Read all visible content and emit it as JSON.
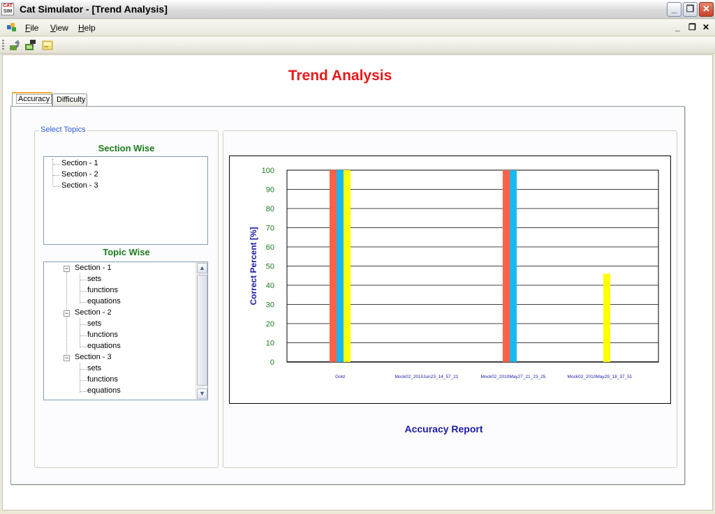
{
  "window": {
    "icon_text_top": "CAT",
    "icon_text_bottom": "SIM",
    "title": "Cat Simulator - [Trend Analysis]",
    "minimize": "_",
    "restore": "❐",
    "close": "✕"
  },
  "menu": {
    "items": [
      {
        "label": "File",
        "accel": "F"
      },
      {
        "label": "View",
        "accel": "V"
      },
      {
        "label": "Help",
        "accel": "H"
      }
    ],
    "mdi_minimize": "_",
    "mdi_restore": "❐",
    "mdi_close": "✕"
  },
  "toolbar": {
    "buttons": [
      "help-icon",
      "tools-icon",
      "report-icon"
    ]
  },
  "page": {
    "title": "Trend Analysis",
    "tabs": [
      {
        "label": "Accuracy",
        "active": true
      },
      {
        "label": "Difficulty",
        "active": false
      }
    ]
  },
  "topics": {
    "group_label": "Select Topics",
    "section_wise_heading": "Section Wise",
    "section_items": [
      "Section - 1",
      "Section - 2",
      "Section - 3"
    ],
    "topic_wise_heading": "Topic Wise",
    "topic_tree": [
      {
        "label": "Section - 1",
        "children": [
          "sets",
          "functions",
          "equations"
        ]
      },
      {
        "label": "Section - 2",
        "children": [
          "sets",
          "functions",
          "equations"
        ]
      },
      {
        "label": "Section - 3",
        "children": [
          "sets",
          "functions",
          "equations"
        ]
      }
    ],
    "expander_glyph": "−"
  },
  "chart_data": {
    "type": "bar",
    "title": "",
    "caption": "Accuracy Report",
    "xlabel": "",
    "ylabel": "Correct Percent [%]",
    "ylim": [
      0,
      100
    ],
    "yticks": [
      0,
      10,
      20,
      30,
      40,
      50,
      60,
      70,
      80,
      90,
      100
    ],
    "grid": true,
    "categories": [
      "Gold",
      "Mock02_2010Jun23_14_57_21",
      "Mock02_2010May27_21_23_25",
      "Mock02_2010May29_18_37_51"
    ],
    "series": [
      {
        "color": "#ff6347",
        "values": [
          100,
          0,
          100,
          0
        ]
      },
      {
        "color": "#1ab8f0",
        "values": [
          100,
          0,
          100,
          0
        ]
      },
      {
        "color": "#ffff00",
        "values": [
          100,
          0,
          0,
          46
        ]
      }
    ],
    "colors": {
      "tick_label": "#1a7a1a",
      "ylabel": "#1a1aa6",
      "category_label": "#1a1aa6"
    }
  }
}
